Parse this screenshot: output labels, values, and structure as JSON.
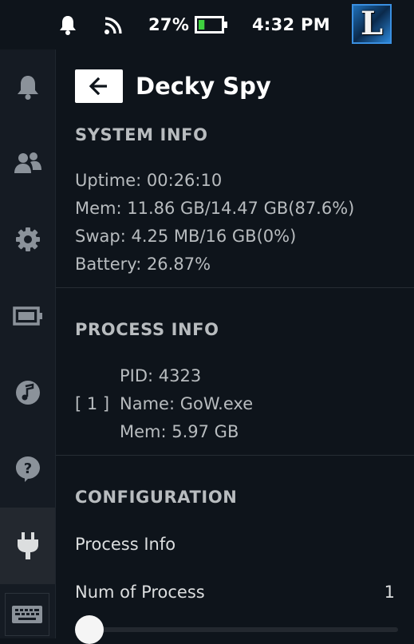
{
  "status_bar": {
    "battery_percent": "27%",
    "battery_level": 0.27,
    "time": "4:32 PM",
    "avatar_letter": "L",
    "icons": [
      "bell-icon",
      "signal-icon",
      "battery-icon"
    ]
  },
  "sidebar": {
    "items": [
      {
        "name": "notifications",
        "icon": "bell-icon"
      },
      {
        "name": "friends",
        "icon": "friends-icon"
      },
      {
        "name": "settings",
        "icon": "gear-icon"
      },
      {
        "name": "performance",
        "icon": "battery-icon"
      },
      {
        "name": "music",
        "icon": "music-icon"
      },
      {
        "name": "help",
        "icon": "help-icon"
      },
      {
        "name": "plugins",
        "icon": "plug-icon",
        "active": true
      }
    ],
    "keyboard_icon": "keyboard-icon"
  },
  "header": {
    "back_icon": "arrow-left-icon",
    "title": "Decky Spy"
  },
  "system_info": {
    "title": "SYSTEM INFO",
    "uptime": "Uptime: 00:26:10",
    "mem": "Mem: 11.86 GB/14.47 GB(87.6%)",
    "swap": "Swap: 4.25 MB/16 GB(0%)",
    "battery": "Battery: 26.87%"
  },
  "process_info": {
    "title": "PROCESS INFO",
    "processes": [
      {
        "index": "[ 1 ]",
        "pid": "PID: 4323",
        "name": "Name: GoW.exe",
        "mem": "Mem: 5.97 GB"
      }
    ]
  },
  "configuration": {
    "title": "CONFIGURATION",
    "process_info_label": "Process Info",
    "num_process_label": "Num of Process",
    "num_process_value": "1",
    "num_process_slider_fraction": 0
  },
  "colors": {
    "background": "#0e141b",
    "sidebar": "#151b23",
    "text": "#b8bcbf",
    "accent_green": "#3fd13f"
  }
}
